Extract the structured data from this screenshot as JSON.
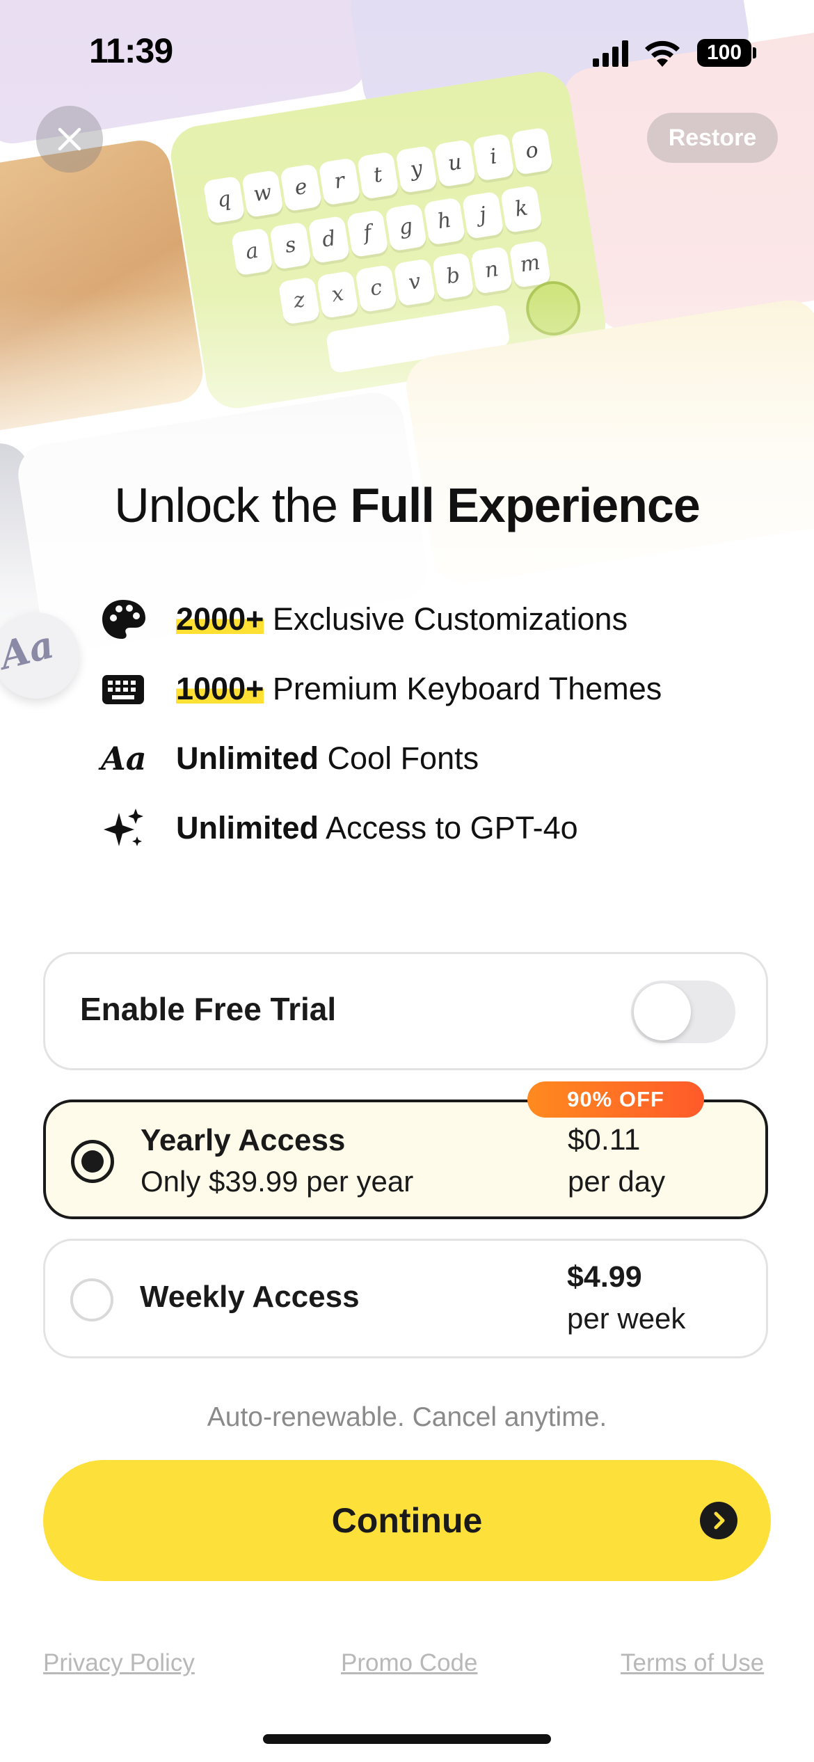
{
  "status_bar": {
    "time": "11:39",
    "battery": "100"
  },
  "top_controls": {
    "close_icon": "close-icon",
    "restore_label": "Restore"
  },
  "hero": {
    "headline_regular": "Unlock the ",
    "headline_bold": "Full Experience",
    "font_badge_text": "Aa"
  },
  "features": [
    {
      "icon": "palette-icon",
      "highlight": "2000+",
      "text": " Exclusive Customizations"
    },
    {
      "icon": "keyboard-icon",
      "highlight": "1000+",
      "text": " Premium Keyboard Themes"
    },
    {
      "icon": "font-icon",
      "icon_text": "Aa",
      "highlight": "Unlimited",
      "text": " Cool Fonts"
    },
    {
      "icon": "sparkle-icon",
      "highlight": "Unlimited",
      "text": " Access to GPT-4o"
    }
  ],
  "trial": {
    "label": "Enable Free Trial",
    "enabled": false
  },
  "plans": {
    "yearly": {
      "badge": "90% OFF",
      "title": "Yearly Access",
      "subtitle": "Only $39.99 per year",
      "price": "$0.11",
      "unit": "per day",
      "selected": true
    },
    "weekly": {
      "title": "Weekly Access",
      "price": "$4.99",
      "unit": "per week",
      "selected": false
    }
  },
  "auto_renew_text": "Auto-renewable. Cancel anytime.",
  "continue_label": "Continue",
  "footer": {
    "privacy": "Privacy Policy",
    "promo": "Promo Code",
    "terms": "Terms of Use"
  },
  "colors": {
    "accent_yellow": "#fde03a",
    "badge_orange": "#ff6a24",
    "highlight_yellow": "#ffe033",
    "selected_plan_bg": "#fffbea"
  }
}
